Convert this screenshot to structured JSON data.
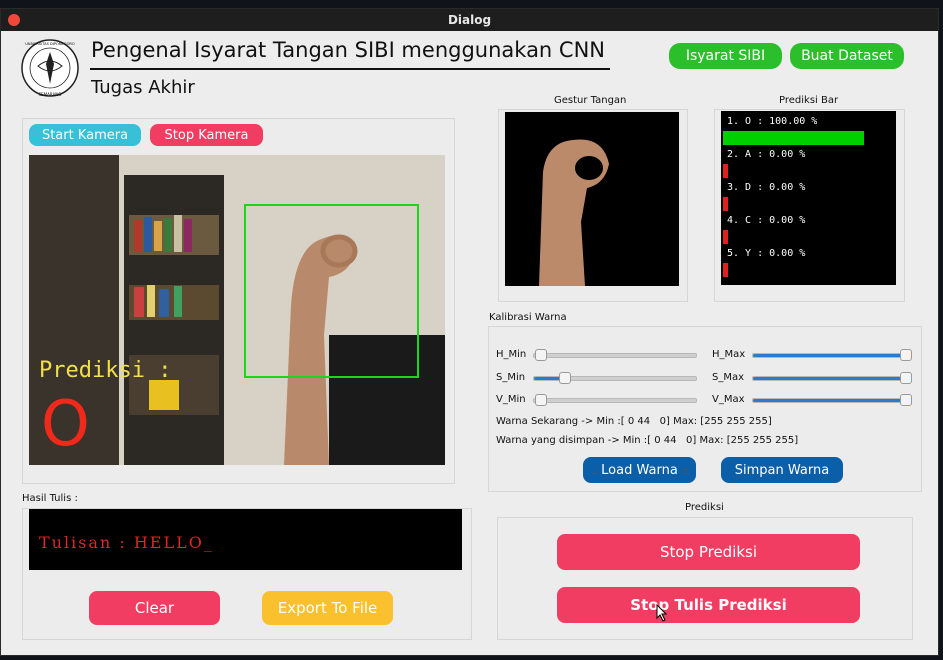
{
  "window": {
    "title": "Dialog"
  },
  "header": {
    "title": "Pengenal Isyarat Tangan SIBI menggunakan CNN",
    "subtitle": "Tugas Akhir",
    "logo_text_top": "UNIVERSITAS DIPONEGORO",
    "logo_text_bottom": "SEMARANG",
    "btn_isyarat": "Isyarat SIBI",
    "btn_dataset": "Buat Dataset"
  },
  "camera": {
    "btn_start": "Start Kamera",
    "btn_stop": "Stop Kamera",
    "overlay_label": "Prediksi :",
    "overlay_letter": "O"
  },
  "gesture": {
    "label": "Gestur Tangan"
  },
  "prediction_bar": {
    "label": "Prediksi Bar",
    "items": [
      {
        "text": "1. O : 100.00 %",
        "value": 1.0
      },
      {
        "text": "2. A : 0.00 %",
        "value": 0.0
      },
      {
        "text": "3. D : 0.00 %",
        "value": 0.0
      },
      {
        "text": "4. C : 0.00 %",
        "value": 0.0
      },
      {
        "text": "5. Y : 0.00 %",
        "value": 0.0
      }
    ],
    "top_color": "#00d000",
    "other_color": "#e02020"
  },
  "calibration": {
    "label": "Kalibrasi Warna",
    "h_min": "H_Min",
    "h_max": "H_Max",
    "s_min": "S_Min",
    "s_max": "S_Max",
    "v_min": "V_Min",
    "v_max": "V_Max",
    "current": "Warna Sekarang -> Min :[ 0 44   0] Max: [255 255 255]",
    "saved": "Warna yang disimpan -> Min :[ 0 44   0] Max: [255 255 255]",
    "btn_load": "Load Warna",
    "btn_save": "Simpan Warna"
  },
  "result": {
    "label": "Hasil Tulis :",
    "text": "Tulisan : HELLO_",
    "btn_clear": "Clear",
    "btn_export": "Export To File"
  },
  "prediksi": {
    "label": "Prediksi",
    "btn_stop": "Stop Prediksi",
    "btn_stop_write": "Stop Tulis Prediksi"
  }
}
